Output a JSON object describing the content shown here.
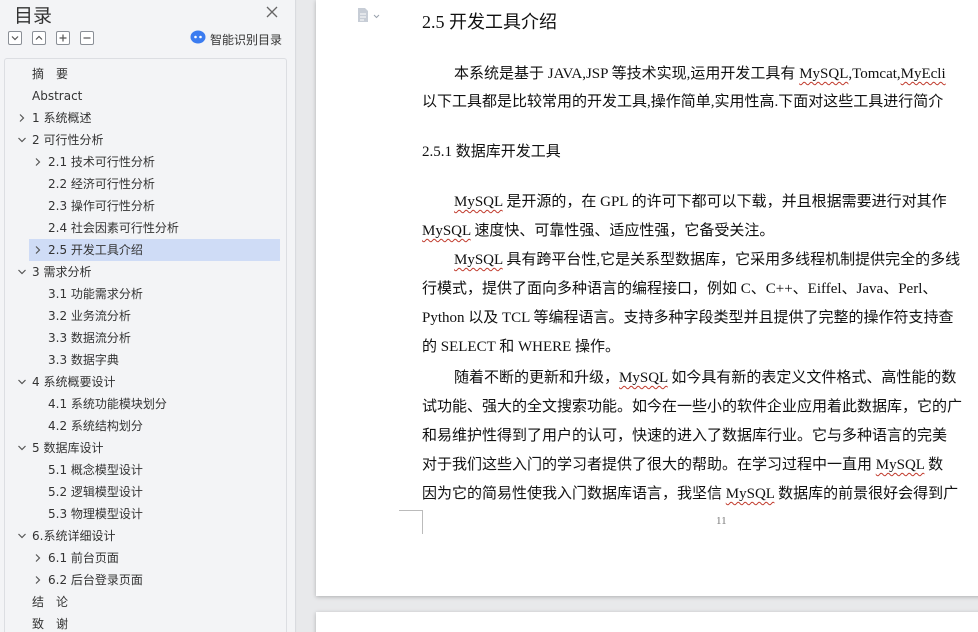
{
  "nav": {
    "title": "目录",
    "smart_label": "智能识别目录",
    "items": [
      {
        "label": "摘　要",
        "level": 0,
        "expand": "none"
      },
      {
        "label": "Abstract",
        "level": 0,
        "expand": "none"
      },
      {
        "label": "1  系统概述",
        "level": 0,
        "expand": "collapsed"
      },
      {
        "label": "2  可行性分析",
        "level": 0,
        "expand": "expanded"
      },
      {
        "label": "2.1  技术可行性分析",
        "level": 1,
        "expand": "collapsed"
      },
      {
        "label": "2.2  经济可行性分析",
        "level": 1,
        "expand": "none"
      },
      {
        "label": "2.3  操作可行性分析",
        "level": 1,
        "expand": "none"
      },
      {
        "label": "2.4  社会因素可行性分析",
        "level": 1,
        "expand": "none"
      },
      {
        "label": "2.5  开发工具介绍",
        "level": 1,
        "expand": "collapsed",
        "active": true
      },
      {
        "label": "3  需求分析",
        "level": 0,
        "expand": "expanded"
      },
      {
        "label": "3.1  功能需求分析",
        "level": 1,
        "expand": "none"
      },
      {
        "label": "3.2  业务流分析",
        "level": 1,
        "expand": "none"
      },
      {
        "label": "3.3  数据流分析",
        "level": 1,
        "expand": "none"
      },
      {
        "label": "3.3  数据字典",
        "level": 1,
        "expand": "none"
      },
      {
        "label": "4  系统概要设计",
        "level": 0,
        "expand": "expanded"
      },
      {
        "label": "4.1  系统功能模块划分",
        "level": 1,
        "expand": "none"
      },
      {
        "label": "4.2  系统结构划分",
        "level": 1,
        "expand": "none"
      },
      {
        "label": "5  数据库设计",
        "level": 0,
        "expand": "expanded"
      },
      {
        "label": "5.1  概念模型设计",
        "level": 1,
        "expand": "none"
      },
      {
        "label": "5.2  逻辑模型设计",
        "level": 1,
        "expand": "none"
      },
      {
        "label": "5.3  物理模型设计",
        "level": 1,
        "expand": "none"
      },
      {
        "label": "6.系统详细设计",
        "level": 0,
        "expand": "expanded"
      },
      {
        "label": "6.1  前台页面",
        "level": 1,
        "expand": "collapsed"
      },
      {
        "label": "6.2  后台登录页面",
        "level": 1,
        "expand": "collapsed"
      },
      {
        "label": "结　论",
        "level": 0,
        "expand": "none"
      },
      {
        "label": "致　谢",
        "level": 0,
        "expand": "none"
      }
    ]
  },
  "doc": {
    "heading": "2.5 开发工具介绍",
    "subheading": "2.5.1 数据库开发工具",
    "page_number": "11",
    "paragraphs": [
      {
        "indent": true,
        "runs": [
          {
            "t": "本系统是基于 JAVA,JSP 等技术实现,运用开发工具有 "
          },
          {
            "t": "MySQL",
            "w": true
          },
          {
            "t": ",Tomcat,"
          },
          {
            "t": "MyEcli",
            "w": true
          }
        ]
      },
      {
        "indent": false,
        "runs": [
          {
            "t": "以下工具都是比较常用的开发工具,操作简单,实用性高.下面对这些工具进行简介"
          }
        ]
      },
      {
        "indent": true,
        "runs": [
          {
            "t": "MySQL",
            "w": true
          },
          {
            "t": " 是开源的，在 GPL 的许可下都可以下载，并且根据需要进行对其作"
          }
        ]
      },
      {
        "indent": false,
        "runs": [
          {
            "t": "MySQL",
            "w": true
          },
          {
            "t": " 速度快、可靠性强、适应性强，它备受关注。"
          }
        ]
      },
      {
        "indent": true,
        "runs": [
          {
            "t": "MySQL",
            "w": true
          },
          {
            "t": " 具有跨平台性,它是关系型数据库，它采用多线程机制提供完全的多线"
          }
        ]
      },
      {
        "indent": false,
        "runs": [
          {
            "t": "行模式，提供了面向多种语言的编程接口，例如 C、C++、Eiffel、Java、Perl、"
          }
        ]
      },
      {
        "indent": false,
        "runs": [
          {
            "t": "Python 以及 TCL 等编程语言。支持多种字段类型并且提供了完整的操作符支持查"
          }
        ]
      },
      {
        "indent": false,
        "runs": [
          {
            "t": "的 SELECT 和 WHERE 操作。"
          }
        ]
      },
      {
        "indent": true,
        "runs": [
          {
            "t": "随着不断的更新和升级，"
          },
          {
            "t": "MySQL",
            "w": true
          },
          {
            "t": " 如今具有新的表定义文件格式、高性能的数"
          }
        ]
      },
      {
        "indent": false,
        "runs": [
          {
            "t": "试功能、强大的全文搜索功能。如今在一些小的软件企业应用着此数据库，它的广"
          }
        ]
      },
      {
        "indent": false,
        "runs": [
          {
            "t": "和易维护性得到了用户的认可，快速的进入了数据库行业。它与多种语言的完美"
          }
        ]
      },
      {
        "indent": false,
        "runs": [
          {
            "t": "对于我们这些入门的学习者提供了很大的帮助。在学习过程中一直用 "
          },
          {
            "t": "MySQL",
            "w": true
          },
          {
            "t": " 数"
          }
        ]
      },
      {
        "indent": false,
        "runs": [
          {
            "t": "因为它的简易性使我入门数据库语言，我坚信 "
          },
          {
            "t": "MySQL",
            "w": true
          },
          {
            "t": " 数据库的前景很好会得到广"
          }
        ]
      }
    ]
  }
}
